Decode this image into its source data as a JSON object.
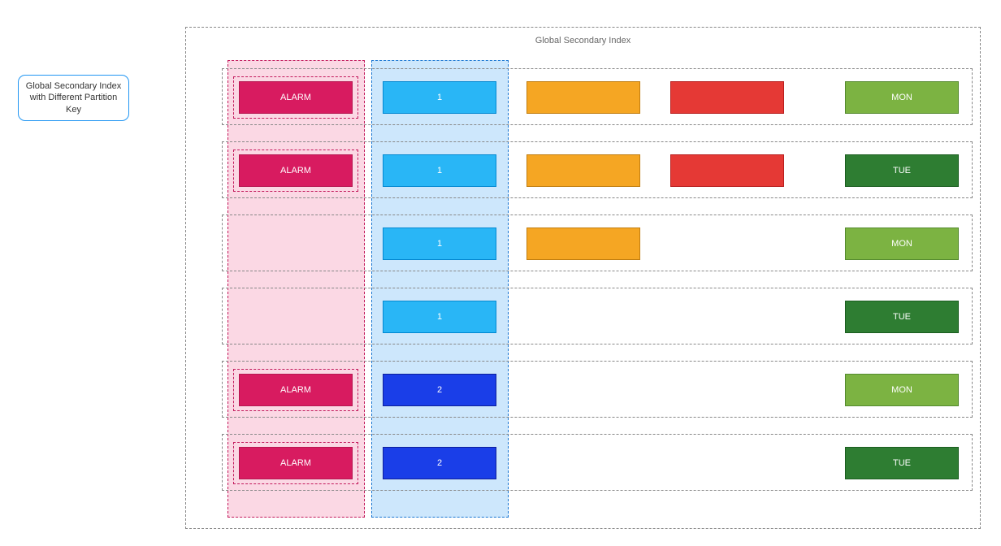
{
  "caption": "Global Secondary Index with Different Partition Key",
  "container_title": "Global Secondary Index",
  "colors": {
    "magenta": "#d81b60",
    "blue_light": "#29b6f6",
    "blue_dark": "#1a3ee8",
    "orange": "#f5a623",
    "red": "#e53935",
    "green_light": "#7cb342",
    "green_dark": "#2e7d32"
  },
  "rows": [
    {
      "partition": "ALARM",
      "sort": "1",
      "sort_variant": "light",
      "col3": true,
      "col4": true,
      "day": "MON",
      "day_variant": "light"
    },
    {
      "partition": "ALARM",
      "sort": "1",
      "sort_variant": "light",
      "col3": true,
      "col4": true,
      "day": "TUE",
      "day_variant": "dark"
    },
    {
      "partition": "",
      "sort": "1",
      "sort_variant": "light",
      "col3": true,
      "col4": false,
      "day": "MON",
      "day_variant": "light"
    },
    {
      "partition": "",
      "sort": "1",
      "sort_variant": "light",
      "col3": false,
      "col4": false,
      "day": "TUE",
      "day_variant": "dark"
    },
    {
      "partition": "ALARM",
      "sort": "2",
      "sort_variant": "dark",
      "col3": false,
      "col4": false,
      "day": "MON",
      "day_variant": "light"
    },
    {
      "partition": "ALARM",
      "sort": "2",
      "sort_variant": "dark",
      "col3": false,
      "col4": false,
      "day": "TUE",
      "day_variant": "dark"
    }
  ]
}
